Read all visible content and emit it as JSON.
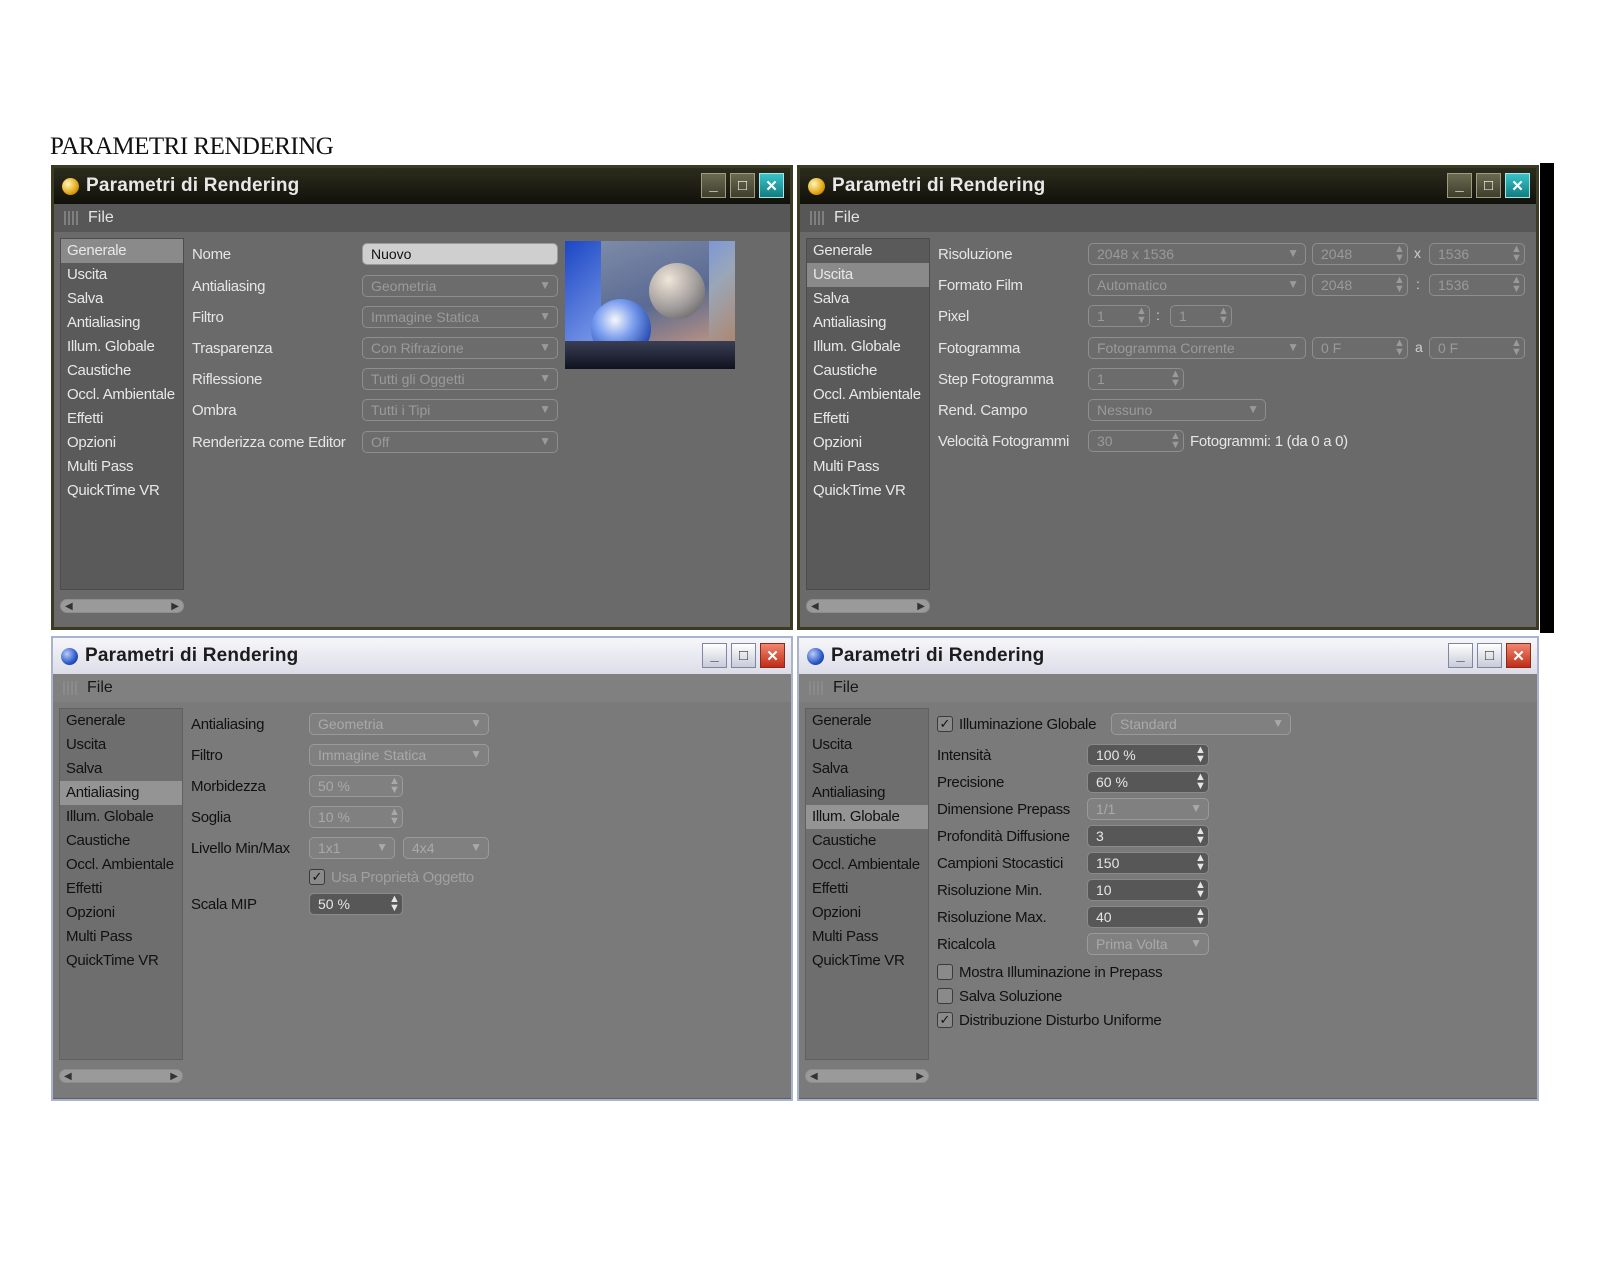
{
  "doc_title": "PARAMETRI RENDERING",
  "window_title": "Parametri  di Rendering",
  "menu_file": "File",
  "sidebar_items": [
    "Generale",
    "Uscita",
    "Salva",
    "Antialiasing",
    "Illum. Globale",
    "Caustiche",
    "Occl. Ambientale",
    "Effetti",
    "Opzioni",
    "Multi Pass",
    "QuickTime VR"
  ],
  "win1": {
    "active_item": "Generale",
    "nome_label": "Nome",
    "nome_value": "Nuovo",
    "antialiasing_label": "Antialiasing",
    "antialiasing_value": "Geometria",
    "filtro_label": "Filtro",
    "filtro_value": "Immagine Statica",
    "trasparenza_label": "Trasparenza",
    "trasparenza_value": "Con Rifrazione",
    "riflessione_label": "Riflessione",
    "riflessione_value": "Tutti gli Oggetti",
    "ombra_label": "Ombra",
    "ombra_value": "Tutti i Tipi",
    "editor_label": "Renderizza come Editor",
    "editor_value": "Off"
  },
  "win2": {
    "active_item": "Uscita",
    "risoluzione_label": "Risoluzione",
    "risoluzione_value": "2048 x 1536",
    "res_w": "2048",
    "res_h": "1536",
    "formato_label": "Formato Film",
    "formato_value": "Automatico",
    "film_w": "2048",
    "film_h": "1536",
    "pixel_label": "Pixel",
    "pixel_a": "1",
    "pixel_b": "1",
    "fotogramma_label": "Fotogramma",
    "fotogramma_value": "Fotogramma Corrente",
    "frame_from": "0 F",
    "frame_to": "0 F",
    "step_label": "Step Fotogramma",
    "step_value": "1",
    "rend_label": "Rend. Campo",
    "rend_value": "Nessuno",
    "velocita_label": "Velocità Fotogrammi",
    "velocita_value": "30",
    "fotogrammi_info": "Fotogrammi: 1 (da 0 a 0)",
    "sep_x": "x",
    "sep_colon": ":",
    "sep_a": "a"
  },
  "win3": {
    "active_item": "Antialiasing",
    "antialiasing_label": "Antialiasing",
    "antialiasing_value": "Geometria",
    "filtro_label": "Filtro",
    "filtro_value": "Immagine Statica",
    "morbidezza_label": "Morbidezza",
    "morbidezza_value": "50 %",
    "soglia_label": "Soglia",
    "soglia_value": "10 %",
    "livello_label": "Livello Min/Max",
    "livello_min": "1x1",
    "livello_max": "4x4",
    "usa_label": "Usa Proprietà Oggetto",
    "scala_label": "Scala MIP",
    "scala_value": "50 %"
  },
  "win4": {
    "active_item": "Illum. Globale",
    "illum_label": "Illuminazione Globale",
    "illum_value": "Standard",
    "intensita_label": "Intensità",
    "intensita_value": "100 %",
    "precisione_label": "Precisione",
    "precisione_value": "60 %",
    "prepass_label": "Dimensione Prepass",
    "prepass_value": "1/1",
    "profondita_label": "Profondità Diffusione",
    "profondita_value": "3",
    "campioni_label": "Campioni Stocastici",
    "campioni_value": "150",
    "rismin_label": "Risoluzione Min.",
    "rismin_value": "10",
    "rismax_label": "Risoluzione Max.",
    "rismax_value": "40",
    "ricalcola_label": "Ricalcola",
    "ricalcola_value": "Prima Volta",
    "mostra_label": "Mostra Illuminazione in Prepass",
    "salva_label": "Salva Soluzione",
    "distribuzione_label": "Distribuzione Disturbo Uniforme"
  }
}
